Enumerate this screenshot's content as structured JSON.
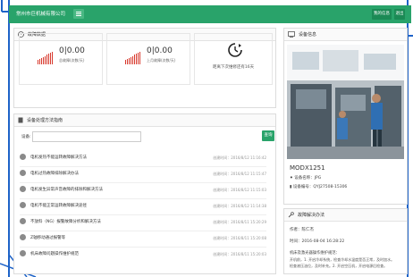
{
  "header": {
    "brand": "常州市巨机械有限公司",
    "btn_personal": "我的信息",
    "btn_exit": "退出"
  },
  "fault_panel": {
    "title": "故障数据",
    "stats": [
      {
        "value": "0|0.00",
        "label": "总故障(次数/天)"
      },
      {
        "value": "0|0.00",
        "label": "上月故障(次数/天)"
      }
    ],
    "next_maint": "距离下次维修还有16天"
  },
  "methods_panel": {
    "title": "设备处理方法指南",
    "search_label": "设备:",
    "search_value": "",
    "search_button": "查询",
    "items": [
      {
        "text": "电机发热不能运转故障解决方法",
        "date": "创建时间：2016/8/12 11:16:42"
      },
      {
        "text": "电机过热故障排除解决办法",
        "date": "创建时间：2016/8/12 11:15:47"
      },
      {
        "text": "电机发生异常声音故障的排除和解决方法",
        "date": "创建时间：2016/8/12 11:15:03"
      },
      {
        "text": "电机不能正常运转故障解决途径",
        "date": "创建时间：2016/8/12 11:14:38"
      },
      {
        "text": "不放料（NG）报警故障分析和解决方法",
        "date": "创建时间：2016/8/11 15:20:29"
      },
      {
        "text": "Z轴移动通过报警等",
        "date": "创建时间：2016/8/11 15:20:08"
      },
      {
        "text": "机床故障问题操作维护规范",
        "date": "创建时间：2016/8/11 15:20:03"
      }
    ]
  },
  "device_panel": {
    "title": "设备信息",
    "model": "MODX1251",
    "name_label": "设备名称：",
    "name_value": "JPG",
    "code_label": "设备编号：",
    "code_value": "QYJ27508-15306"
  },
  "repair_panel": {
    "title": "故障解决办法",
    "author_label": "作者：",
    "author_value": "陈仁杰",
    "time_label": "时间：",
    "time_value": "2016-08-04 16:28:22",
    "body_title": "机床及激光器操作维护规范：",
    "body_line1": "开机前，1. 开启冷却系统，检查冷却水温度是否正常，及时加水。",
    "body_line2": "检查液压油位，及时补充。2. 开启空压机，开启电源后检查。"
  }
}
